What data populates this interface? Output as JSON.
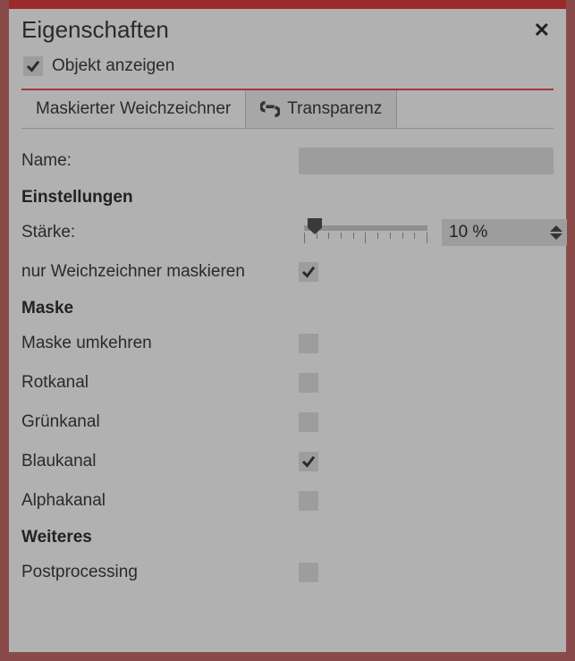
{
  "header": {
    "title": "Eigenschaften"
  },
  "showObject": {
    "label": "Objekt anzeigen",
    "checked": true
  },
  "tabs": {
    "active": "Maskierter Weichzeichner",
    "inactive": "Transparenz"
  },
  "fields": {
    "name": {
      "label": "Name:",
      "value": ""
    }
  },
  "sections": {
    "settings": "Einstellungen",
    "mask": "Maske",
    "more": "Weiteres"
  },
  "strength": {
    "label": "Stärke:",
    "value_text": "10 %",
    "percent": 10
  },
  "maskOnly": {
    "label": "nur Weichzeichner maskieren",
    "checked": true
  },
  "maskOptions": {
    "invert": {
      "label": "Maske umkehren",
      "checked": false
    },
    "red": {
      "label": "Rotkanal",
      "checked": false
    },
    "green": {
      "label": "Grünkanal",
      "checked": false
    },
    "blue": {
      "label": "Blaukanal",
      "checked": true
    },
    "alpha": {
      "label": "Alphakanal",
      "checked": false
    }
  },
  "postprocessing": {
    "label": "Postprocessing",
    "checked": false
  }
}
